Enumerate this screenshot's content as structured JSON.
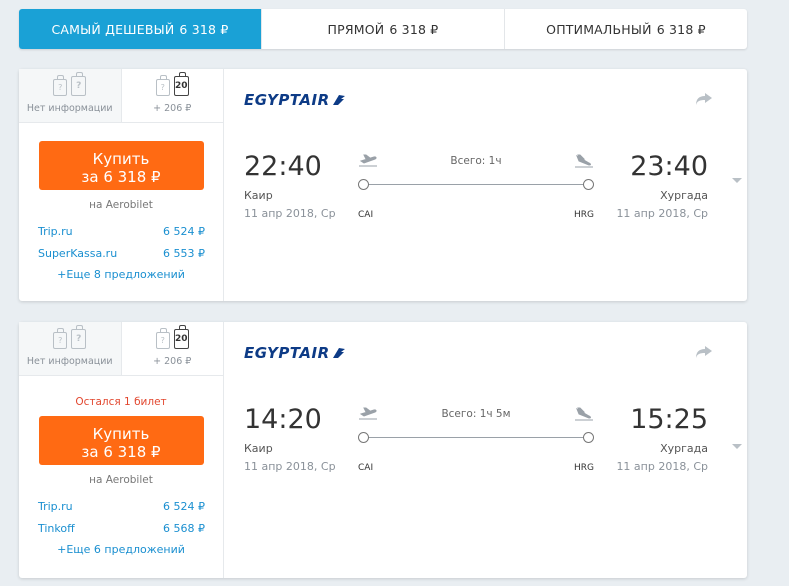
{
  "tabs": [
    {
      "label": "САМЫЙ ДЕШЕВЫЙ",
      "price": "6 318 ₽"
    },
    {
      "label": "ПРЯМОЙ",
      "price": "6 318 ₽"
    },
    {
      "label": "ОПТИМАЛЬНЫЙ",
      "price": "6 318 ₽"
    }
  ],
  "cards": [
    {
      "baggage": {
        "no_info": "Нет информации",
        "extra": "+ 206 ₽",
        "weight": "20"
      },
      "warning": "",
      "buy": {
        "label": "Купить",
        "price": "за 6 318 ₽"
      },
      "agency": "на Aerobilet",
      "offers": [
        {
          "name": "Trip.ru",
          "price": "6 524 ₽"
        },
        {
          "name": "SuperKassa.ru",
          "price": "6 553 ₽"
        }
      ],
      "more": "+Еще 8 предложений",
      "airline": "EGYPTAIR",
      "departure": {
        "time": "22:40",
        "city": "Каир",
        "date": "11 апр 2018, Ср",
        "code": "CAI"
      },
      "arrival": {
        "time": "23:40",
        "city": "Хургада",
        "date": "11 апр 2018, Ср",
        "code": "HRG"
      },
      "duration": "Всего: 1ч"
    },
    {
      "baggage": {
        "no_info": "Нет информации",
        "extra": "+ 206 ₽",
        "weight": "20"
      },
      "warning": "Остался 1 билет",
      "buy": {
        "label": "Купить",
        "price": "за 6 318 ₽"
      },
      "agency": "на Aerobilet",
      "offers": [
        {
          "name": "Trip.ru",
          "price": "6 524 ₽"
        },
        {
          "name": "Tinkoff",
          "price": "6 568 ₽"
        }
      ],
      "more": "+Еще 6 предложений",
      "airline": "EGYPTAIR",
      "departure": {
        "time": "14:20",
        "city": "Каир",
        "date": "11 апр 2018, Ср",
        "code": "CAI"
      },
      "arrival": {
        "time": "15:25",
        "city": "Хургада",
        "date": "11 апр 2018, Ср",
        "code": "HRG"
      },
      "duration": "Всего: 1ч 5м"
    }
  ],
  "colors": {
    "accent": "#1aa1d6",
    "buy": "#ff6a13",
    "link": "#1a8fd0",
    "warning": "#e2472f",
    "airline": "#0d3b86"
  }
}
